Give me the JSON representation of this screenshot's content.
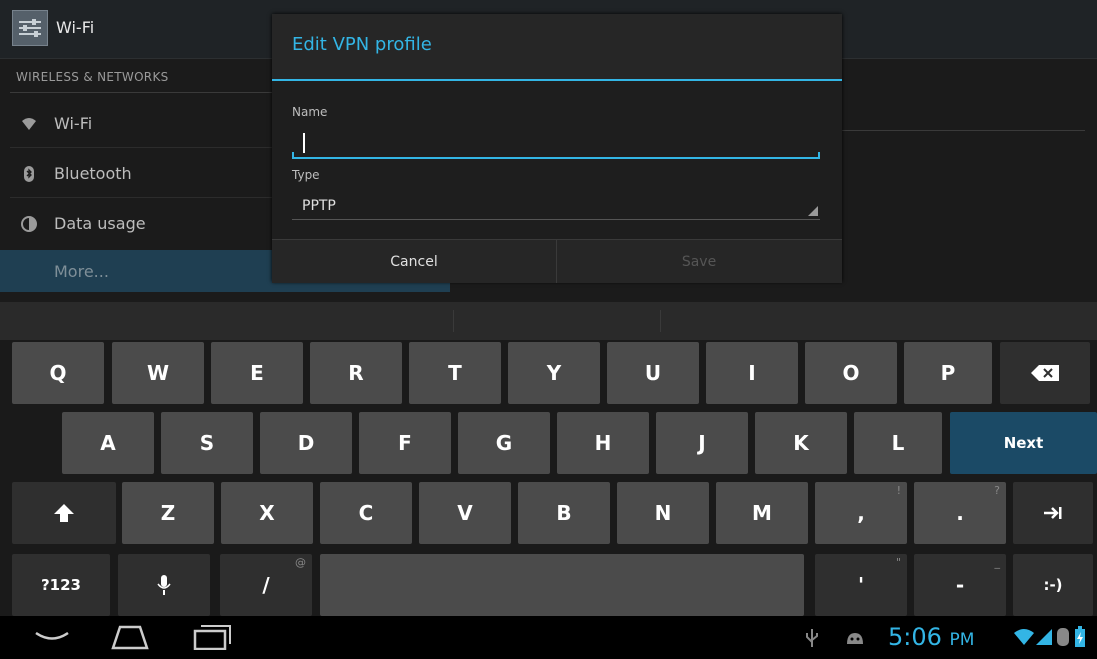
{
  "header": {
    "title": "Wi-Fi"
  },
  "settings": {
    "section_header": "WIRELESS & NETWORKS",
    "items": [
      {
        "icon": "wifi-icon",
        "label": "Wi-Fi"
      },
      {
        "icon": "bluetooth-icon",
        "label": "Bluetooth"
      },
      {
        "icon": "data-usage-icon",
        "label": "Data usage"
      },
      {
        "icon": "",
        "label": "More..."
      }
    ]
  },
  "dialog": {
    "title": "Edit VPN profile",
    "name_label": "Name",
    "name_value": "",
    "type_label": "Type",
    "type_value": "PPTP",
    "cancel_label": "Cancel",
    "save_label": "Save",
    "accent_color": "#33b5e5"
  },
  "keyboard": {
    "row1": [
      "Q",
      "W",
      "E",
      "R",
      "T",
      "Y",
      "U",
      "I",
      "O",
      "P"
    ],
    "row2": [
      "A",
      "S",
      "D",
      "F",
      "G",
      "H",
      "J",
      "K",
      "L"
    ],
    "row2_action": "Next",
    "row3": [
      "Z",
      "X",
      "C",
      "V",
      "B",
      "N",
      "M"
    ],
    "row3_punct": [
      {
        "key": ",",
        "hint": "!"
      },
      {
        "key": ".",
        "hint": "?"
      }
    ],
    "row4": {
      "symbols": "?123",
      "slash": "/",
      "slash_hint": "@",
      "apostrophe": "'",
      "apostrophe_hint": "\"",
      "dash": "-",
      "dash_hint": "_",
      "smiley": ":-)"
    }
  },
  "navbar": {
    "time": "5:06",
    "ampm": "PM"
  }
}
